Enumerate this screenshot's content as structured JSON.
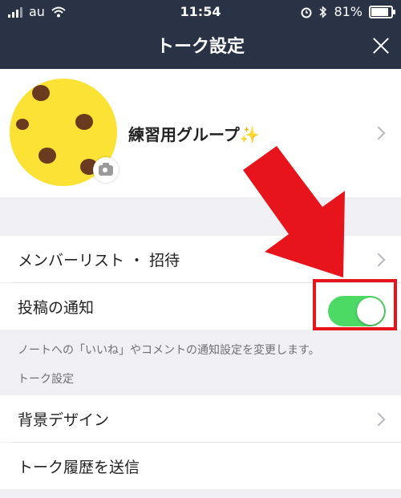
{
  "status_bar": {
    "carrier": "au",
    "time": "11:54",
    "battery": "81%"
  },
  "header": {
    "title": "トーク設定"
  },
  "profile": {
    "group_name": "練習用グループ✨"
  },
  "settings": {
    "member_list": "メンバーリスト ・ 招待",
    "post_notification": "投稿の通知",
    "post_notification_hint": "ノートへの「いいね」やコメントの通知設定を変更します。",
    "section_header": "トーク設定",
    "background_design": "背景デザイン",
    "send_history": "トーク履歴を送信"
  },
  "toggle_post_notification": {
    "state": "on"
  },
  "colors": {
    "header_bg": "#2a3346",
    "toggle_on": "#4cd964",
    "annotation": "#e8141b"
  }
}
